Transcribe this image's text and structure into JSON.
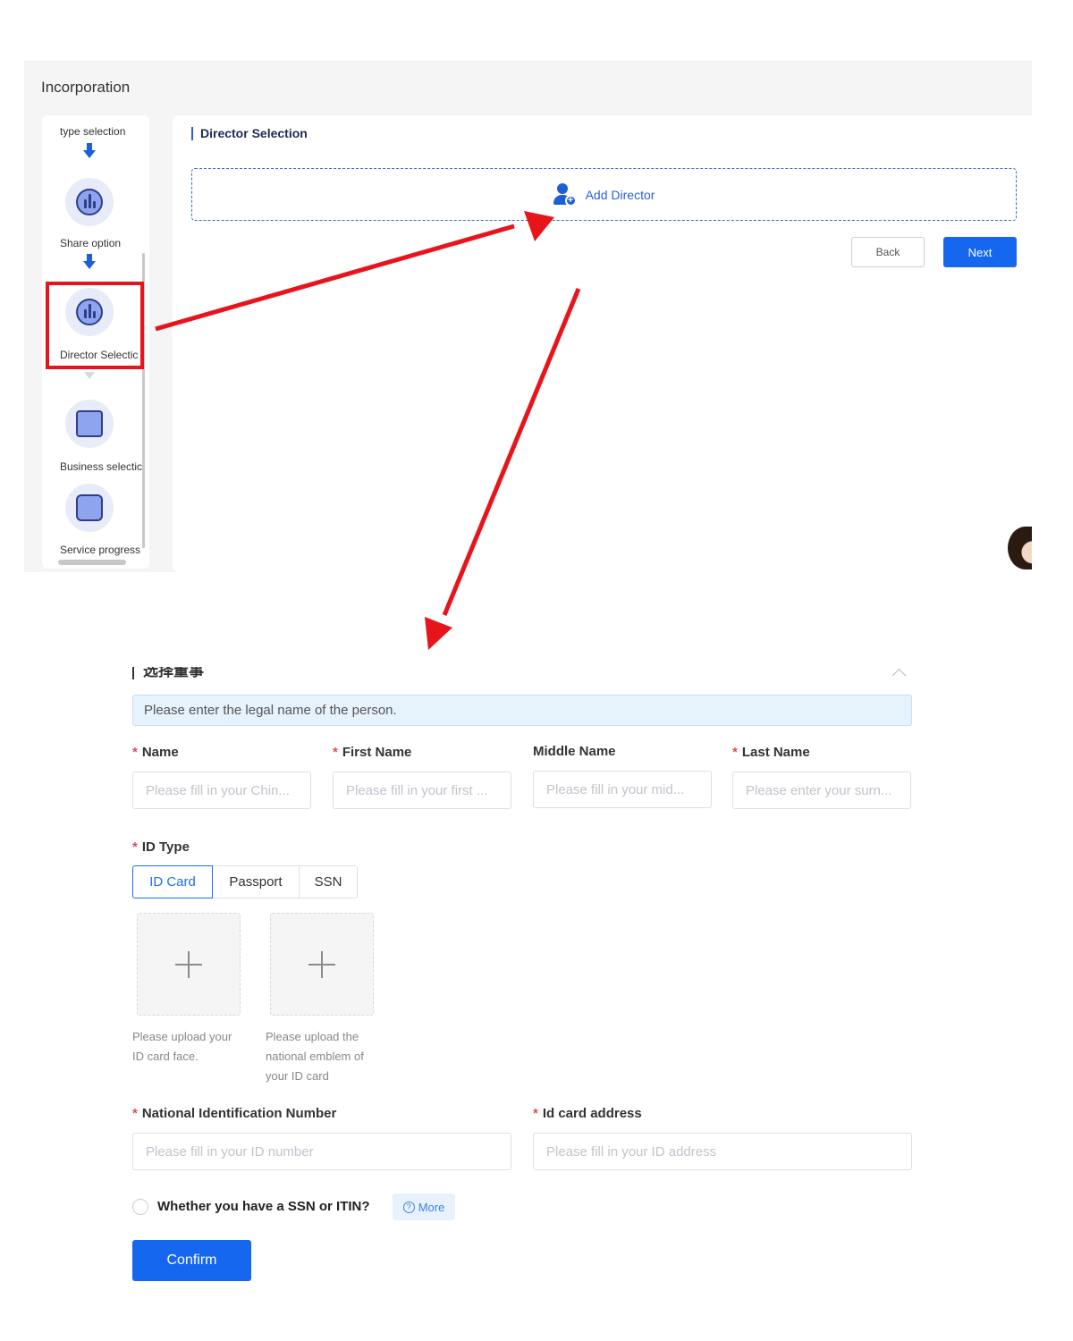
{
  "top": {
    "app_title": "Incorporation",
    "steps": [
      {
        "label": "type selection"
      },
      {
        "label": "Share option"
      },
      {
        "label": "Director Selectic"
      },
      {
        "label": "Business selectic"
      },
      {
        "label": "Service progress"
      }
    ],
    "section_title": "Director Selection",
    "add_director_label": "Add Director",
    "back_label": "Back",
    "next_label": "Next"
  },
  "form": {
    "heading": "选择董事",
    "notice": "Please enter the legal name of the person.",
    "fields": {
      "name": {
        "label": "Name",
        "placeholder": "Please fill in your Chin..."
      },
      "first_name": {
        "label": "First Name",
        "placeholder": "Please fill in your first ..."
      },
      "middle_name": {
        "label": "Middle Name",
        "placeholder": "Please fill in your mid..."
      },
      "last_name": {
        "label": "Last Name",
        "placeholder": "Please enter your surn..."
      },
      "id_type": {
        "label": "ID Type",
        "options": [
          "ID Card",
          "Passport",
          "SSN"
        ],
        "selected": "ID Card"
      },
      "upload_face_tip": "Please upload your ID card face.",
      "upload_emblem_tip": "Please upload the national emblem of your ID card",
      "national_id": {
        "label": "National Identification Number",
        "placeholder": "Please fill in your ID number"
      },
      "id_address": {
        "label": "Id card address",
        "placeholder": "Please fill in your ID address"
      }
    },
    "ssn_question": "Whether you have a SSN or ITIN?",
    "more_label": "More",
    "confirm_label": "Confirm"
  },
  "colors": {
    "primary": "#1567f0",
    "highlight": "#e8141c",
    "required": "#e64c4c"
  }
}
